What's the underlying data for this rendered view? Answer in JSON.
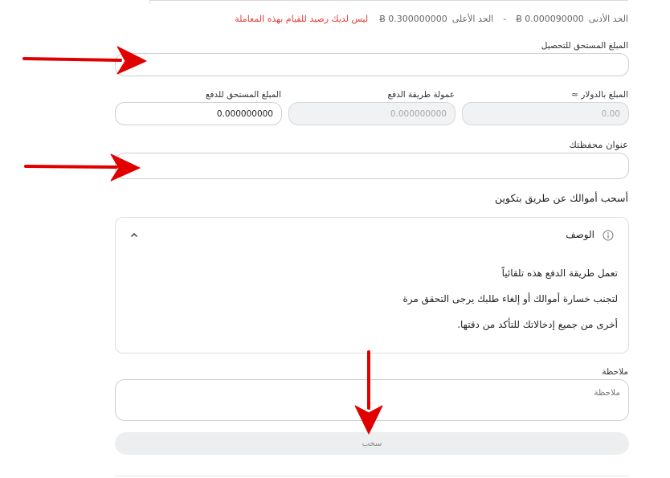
{
  "limits": {
    "min_label": "الحد الأدنى",
    "min_value": "Ƀ 0.000090000",
    "separator": "-",
    "max_label": "الحد الأعلى",
    "max_value": "Ƀ 0.300000000",
    "warning": "ليس لديك رصيد للقيام بهذه المعاملة"
  },
  "form": {
    "amount_due_label": "المبلغ المستحق للتحصيل",
    "amount_due_value": "",
    "usd_amount_label": "المبلغ بالدولار ≈",
    "usd_amount_value": "0.00",
    "fee_label": "عمولة طريقة الدفع",
    "fee_value": "0.000000000",
    "payable_label": "المبلغ المستحق للدفع",
    "payable_value": "0.000000000",
    "wallet_label": "عنوان محفظتك",
    "wallet_value": "",
    "section_title": "أسحب أموالك عن طريق بتكوين",
    "note_label": "ملاحظة",
    "note_placeholder": "ملاحظة",
    "submit_label": "سحب"
  },
  "description": {
    "title": "الوصف",
    "lines": [
      "تعمل طريقة الدفع هذه تلقائياً",
      "لتجنب خسارة أموالك أو إلغاء طلبك يرجى التحقق مرة",
      "أخرى من جميع إدخالاتك للتأكد من دقتها."
    ]
  },
  "colors": {
    "warning": "#e53935",
    "annotation_arrow": "#e00000"
  },
  "icons": {
    "info": "info-circle-icon",
    "collapse": "chevron-up-icon",
    "annotation": "red-arrow-icon"
  }
}
